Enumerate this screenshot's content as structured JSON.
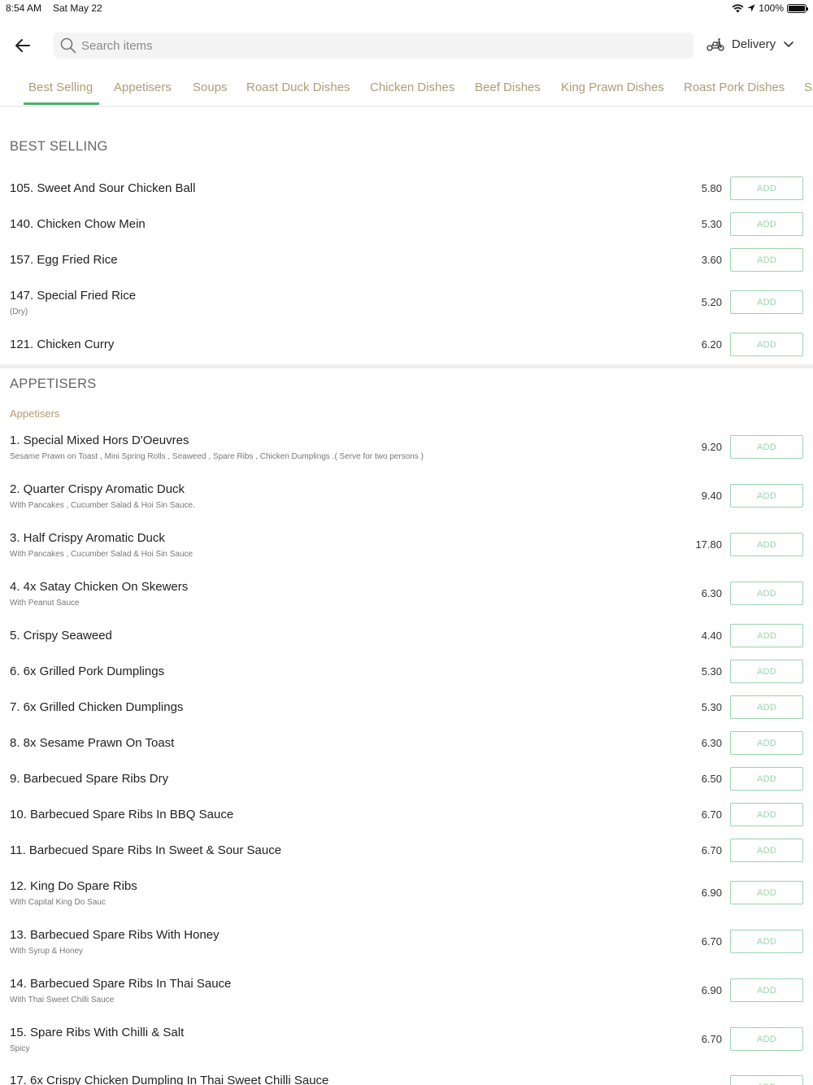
{
  "status": {
    "time": "8:54 AM",
    "date": "Sat May 22",
    "battery": "100%"
  },
  "search": {
    "placeholder": "Search items"
  },
  "delivery_label": "Delivery",
  "tabs": [
    {
      "label": "Best Selling"
    },
    {
      "label": "Appetisers"
    },
    {
      "label": "Soups"
    },
    {
      "label": "Roast Duck Dishes"
    },
    {
      "label": "Chicken Dishes"
    },
    {
      "label": "Beef Dishes"
    },
    {
      "label": "King Prawn Dishes"
    },
    {
      "label": "Roast Pork Dishes"
    },
    {
      "label": "S"
    }
  ],
  "add_label": "ADD",
  "best_selling": {
    "title": "BEST SELLING",
    "items": [
      {
        "name": "105. Sweet And Sour Chicken Ball",
        "price": "5.80"
      },
      {
        "name": "140. Chicken Chow Mein",
        "price": "5.30"
      },
      {
        "name": "157. Egg Fried Rice",
        "price": "3.60"
      },
      {
        "name": "147. Special Fried Rice",
        "desc": "(Dry)",
        "price": "5.20"
      },
      {
        "name": "121. Chicken Curry",
        "price": "6.20"
      }
    ]
  },
  "appetisers": {
    "title": "APPETISERS",
    "subcategory": "Appetisers",
    "items": [
      {
        "name": "1. Special Mixed Hors D'Oeuvres",
        "desc": "Sesame Prawn on Toast , Mini Spring Rolls , Seaweed , Spare Ribs , Chicken Dumplings .( Serve for two persons )",
        "price": "9.20"
      },
      {
        "name": "2. Quarter Crispy Aromatic Duck",
        "desc": "With Pancakes , Cucumber Salad & Hoi Sin Sauce.",
        "price": "9.40"
      },
      {
        "name": "3. Half Crispy Aromatic Duck",
        "desc": "With Pancakes , Cucumber Salad & Hoi Sin Sauce",
        "price": "17.80"
      },
      {
        "name": "4. 4x Satay Chicken On Skewers",
        "desc": "With Peanut Sauce",
        "price": "6.30"
      },
      {
        "name": "5. Crispy Seaweed",
        "price": "4.40"
      },
      {
        "name": "6. 6x Grilled Pork Dumplings",
        "price": "5.30"
      },
      {
        "name": "7. 6x Grilled Chicken Dumplings",
        "price": "5.30"
      },
      {
        "name": "8. 8x Sesame Prawn On Toast",
        "price": "6.30"
      },
      {
        "name": "9. Barbecued Spare Ribs Dry",
        "price": "6.50"
      },
      {
        "name": "10. Barbecued Spare Ribs In BBQ Sauce",
        "price": "6.70"
      },
      {
        "name": "11. Barbecued Spare Ribs In Sweet & Sour Sauce",
        "price": "6.70"
      },
      {
        "name": "12. King Do Spare Ribs",
        "desc": "With Capital King Do Sauc",
        "price": "6.90"
      },
      {
        "name": "13. Barbecued Spare Ribs With Honey",
        "desc": "With Syrup & Honey",
        "price": "6.70"
      },
      {
        "name": "14. Barbecued Spare Ribs In Thai Sauce",
        "desc": "With Thai Sweet Chilli Sauce",
        "price": "6.90"
      },
      {
        "name": "15. Spare Ribs With Chilli & Salt",
        "desc": "Spicy",
        "price": "6.70"
      },
      {
        "name": "17. 6x Crispy Chicken Dumpling In Thai Sweet Chilli Sauce"
      }
    ]
  }
}
